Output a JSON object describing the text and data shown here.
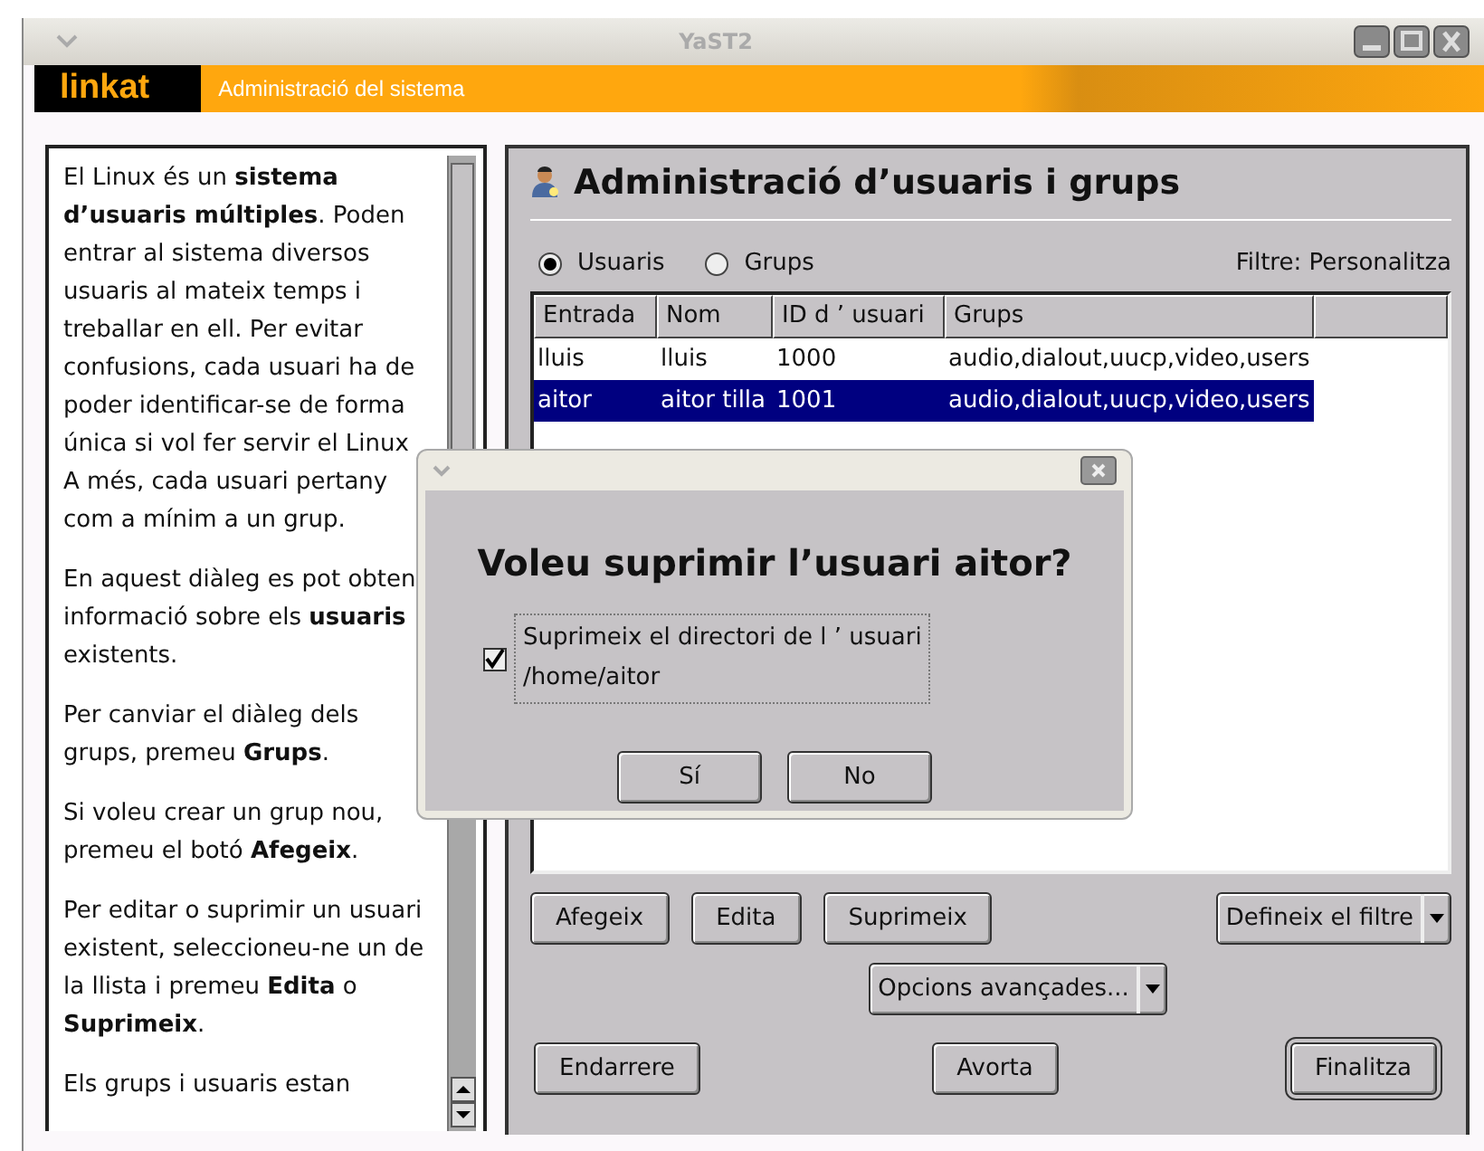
{
  "window": {
    "title": "YaST2"
  },
  "banner": {
    "logo": "linkat",
    "title": "Administració del sistema"
  },
  "help": {
    "paragraphs": [
      [
        "El Linux és un **sistema**",
        "**d’usuaris múltiples**. Poden",
        "entrar al sistema diversos",
        "usuaris al mateix temps i",
        "treballar en ell. Per evitar",
        "confusions, cada usuari ha de",
        "poder identificar-se de forma",
        "única si vol fer servir el Linux",
        "A més, cada usuari pertany",
        "com a mínim a un grup."
      ],
      [
        "En aquest diàleg es pot obten",
        "informació sobre els **usuaris**",
        "existents."
      ],
      [
        "Per canviar el diàleg dels",
        "grups, premeu **Grups**."
      ],
      [
        "Si voleu crear un grup nou,",
        "premeu el botó **Afegeix**."
      ],
      [
        "Per editar o suprimir un usuari",
        "existent, seleccioneu-ne un de",
        "la llista i premeu **Edita** o",
        "**Suprimeix**."
      ],
      [
        "Els grups i usuaris estan"
      ]
    ]
  },
  "panel": {
    "title": "Administració d’usuaris i grups",
    "view_options": [
      {
        "label": "Usuaris",
        "selected": true
      },
      {
        "label": "Grups",
        "selected": false
      }
    ],
    "filter": "Filtre: Personalitza",
    "table": {
      "columns": [
        "Entrada",
        "Nom",
        "ID d ’ usuari",
        "Grups"
      ],
      "rows": [
        {
          "cells": [
            "lluis",
            "lluis",
            "1000",
            "audio,dialout,uucp,video,users"
          ],
          "selected": false
        },
        {
          "cells": [
            "aitor",
            "aitor tilla",
            "1001",
            "audio,dialout,uucp,video,users"
          ],
          "selected": true
        }
      ]
    },
    "buttons": [
      {
        "label": "Afegeix",
        "kind": "plain"
      },
      {
        "label": "Edita",
        "kind": "plain"
      },
      {
        "label": "Suprimeix",
        "kind": "plain"
      },
      {
        "label": "Defineix el filtre",
        "kind": "menu"
      }
    ],
    "advanced": {
      "label": "Opcions avançades...",
      "kind": "menu"
    },
    "nav_buttons": [
      {
        "label": "Endarrere",
        "kind": "plain"
      },
      {
        "label": "Avorta",
        "kind": "plain"
      },
      {
        "label": "Finalitza",
        "kind": "default"
      }
    ]
  },
  "dialog": {
    "question": "Voleu suprimir l’usuari aitor?",
    "checkbox": {
      "lines": [
        "Suprimeix el directori de l ’ usuari",
        "/home/aitor"
      ],
      "checked": true
    },
    "buttons": [
      {
        "label": "Sí"
      },
      {
        "label": "No"
      }
    ]
  }
}
